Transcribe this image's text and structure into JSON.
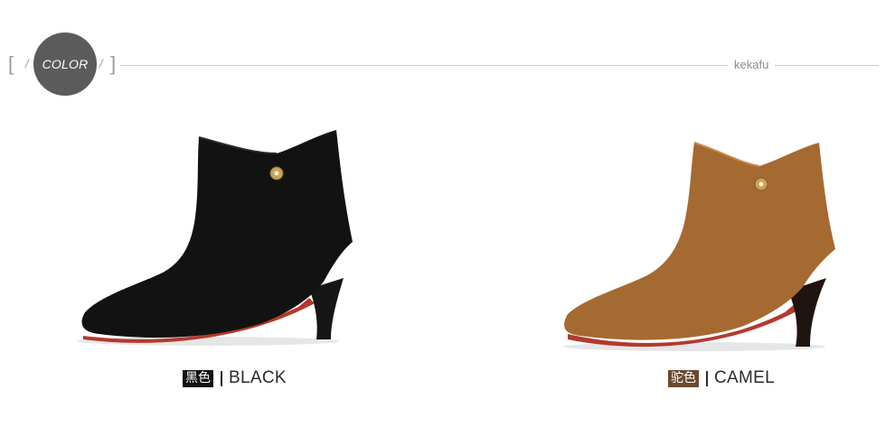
{
  "header": {
    "color_label": "COLOR",
    "brand": "kekafu"
  },
  "colors": {
    "circle": "#5b5b5b",
    "black_tag": "#111111",
    "camel_tag": "#6b4a2f",
    "black_shoe": "#141414",
    "camel_shoe": "#a8692f",
    "sole_red": "#c0392b"
  },
  "products": [
    {
      "tag": "黑色",
      "name": "BLACK",
      "image": "black-suede-ankle-boot"
    },
    {
      "tag": "驼色",
      "name": "CAMEL",
      "image": "camel-suede-ankle-boot"
    }
  ]
}
